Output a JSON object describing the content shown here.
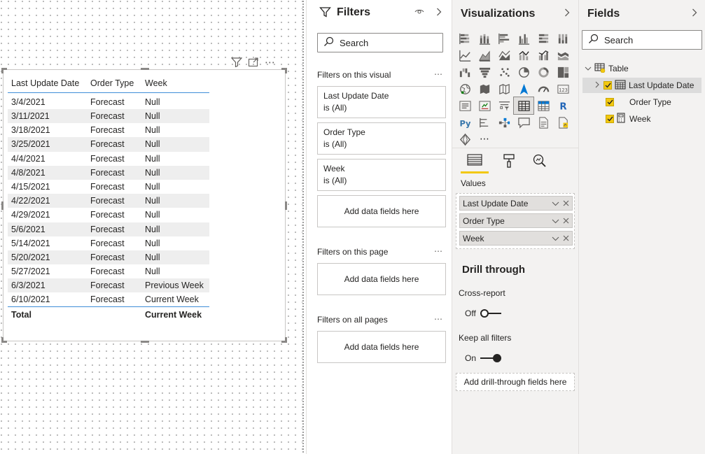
{
  "table_visual": {
    "columns": [
      "Last Update Date",
      "Order Type",
      "Week"
    ],
    "rows": [
      [
        "3/4/2021",
        "Forecast",
        "Null"
      ],
      [
        "3/11/2021",
        "Forecast",
        "Null"
      ],
      [
        "3/18/2021",
        "Forecast",
        "Null"
      ],
      [
        "3/25/2021",
        "Forecast",
        "Null"
      ],
      [
        "4/4/2021",
        "Forecast",
        "Null"
      ],
      [
        "4/8/2021",
        "Forecast",
        "Null"
      ],
      [
        "4/15/2021",
        "Forecast",
        "Null"
      ],
      [
        "4/22/2021",
        "Forecast",
        "Null"
      ],
      [
        "4/29/2021",
        "Forecast",
        "Null"
      ],
      [
        "5/6/2021",
        "Forecast",
        "Null"
      ],
      [
        "5/14/2021",
        "Forecast",
        "Null"
      ],
      [
        "5/20/2021",
        "Forecast",
        "Null"
      ],
      [
        "5/27/2021",
        "Forecast",
        "Null"
      ],
      [
        "6/3/2021",
        "Forecast",
        "Previous Week"
      ],
      [
        "6/10/2021",
        "Forecast",
        "Current Week"
      ]
    ],
    "total": {
      "label": "Total",
      "order_type": "",
      "week": "Current Week"
    },
    "toolbar_icons": [
      "filter-icon",
      "focus-mode-icon",
      "more-options-icon"
    ],
    "more_glyph": "⋯"
  },
  "filters": {
    "title": "Filters",
    "icons": [
      "eye-icon",
      "chevron-right-icon"
    ],
    "search_placeholder": "Search",
    "section_visual": "Filters on this visual",
    "section_page": "Filters on this page",
    "section_all": "Filters on all pages",
    "more_glyph": "⋯",
    "cards": [
      {
        "name": "Last Update Date",
        "state": "is (All)"
      },
      {
        "name": "Order Type",
        "state": "is (All)"
      },
      {
        "name": "Week",
        "state": "is (All)"
      }
    ],
    "add_fields": "Add data fields here"
  },
  "visualizations": {
    "title": "Visualizations",
    "chevron": "›",
    "more_glyph": "⋯",
    "tabs": [
      "fields-tab-icon",
      "format-paint-icon",
      "analytics-icon"
    ],
    "values_label": "Values",
    "value_fields": [
      "Last Update Date",
      "Order Type",
      "Week"
    ],
    "drill_title": "Drill through",
    "cross_report_label": "Cross-report",
    "cross_report_state": "Off",
    "keep_filters_label": "Keep all filters",
    "keep_filters_state": "On",
    "add_drill": "Add drill-through fields here"
  },
  "fields": {
    "title": "Fields",
    "chevron": "›",
    "search_placeholder": "Search",
    "table_name": "Table",
    "items": [
      "Last Update Date",
      "Order Type",
      "Week"
    ]
  },
  "colors": {
    "accent_yellow": "#f2c811",
    "header_rule_blue": "#3f8ed8",
    "pane_bg": "#f3f2f1"
  }
}
